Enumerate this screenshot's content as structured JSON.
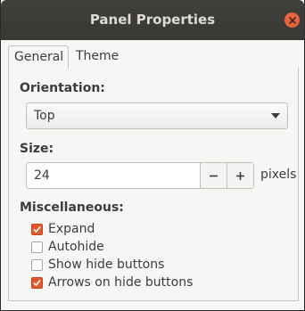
{
  "window": {
    "title": "Panel Properties",
    "close_icon": "close-icon"
  },
  "tabs": [
    {
      "label": "General",
      "active": true
    },
    {
      "label": "Theme",
      "active": false
    }
  ],
  "orientation": {
    "label": "Orientation:",
    "value": "Top"
  },
  "size": {
    "label": "Size:",
    "value": "24",
    "unit": "pixels",
    "minus": "−",
    "plus": "+"
  },
  "misc": {
    "label": "Miscellaneous:",
    "options": [
      {
        "label": "Expand",
        "checked": true
      },
      {
        "label": "Autohide",
        "checked": false
      },
      {
        "label": "Show hide buttons",
        "checked": false
      },
      {
        "label": "Arrows on hide buttons",
        "checked": true
      }
    ]
  },
  "colors": {
    "accent": "#e0582c",
    "titlebar": "#3c3c39",
    "close": "#e9643a"
  }
}
